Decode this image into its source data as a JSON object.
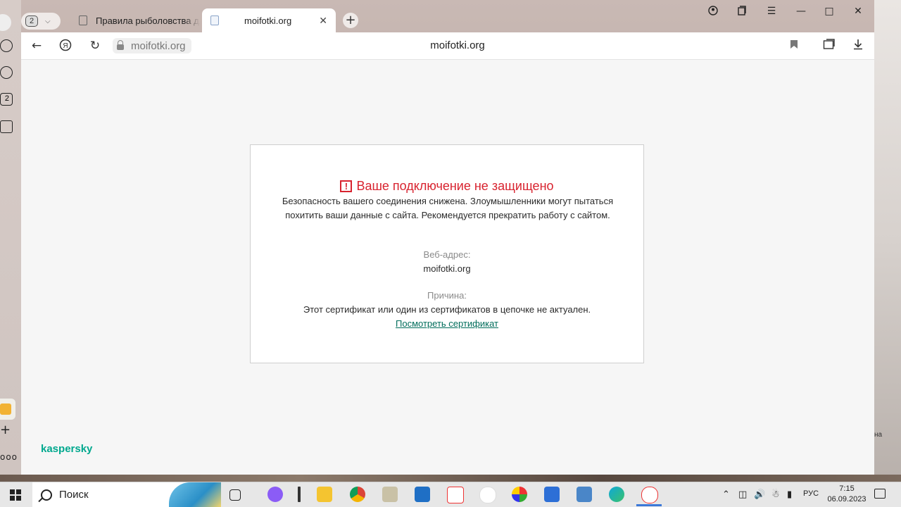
{
  "browser": {
    "tab_count": "2",
    "tabs": [
      {
        "title": "Правила рыболовства для"
      },
      {
        "title": "moifotki.org"
      }
    ],
    "address": "moifotki.org",
    "page_title": "moifotki.org"
  },
  "warning": {
    "heading": "Ваше подключение не защищено",
    "description": "Безопасность вашего соединения снижена. Злоумышленники могут пытаться похитить ваши данные с сайта. Рекомендуется прекратить работу с сайтом.",
    "address_label": "Веб-адрес:",
    "address_value": "moifotki.org",
    "reason_label": "Причина:",
    "reason_value": "Этот сертификат или один из сертификатов в цепочке не актуален.",
    "view_cert_link": "Посмотреть сертификат",
    "brand": "kaspersky",
    "colors": {
      "heading": "#d8232f",
      "link": "#006d5b",
      "brand": "#00a88e"
    }
  },
  "sidebar": {
    "badge": "2"
  },
  "desktop": {
    "fragment": "на"
  },
  "taskbar": {
    "search_label": "Поиск",
    "language": "РУС",
    "time": "7:15",
    "date": "06.09.2023"
  }
}
